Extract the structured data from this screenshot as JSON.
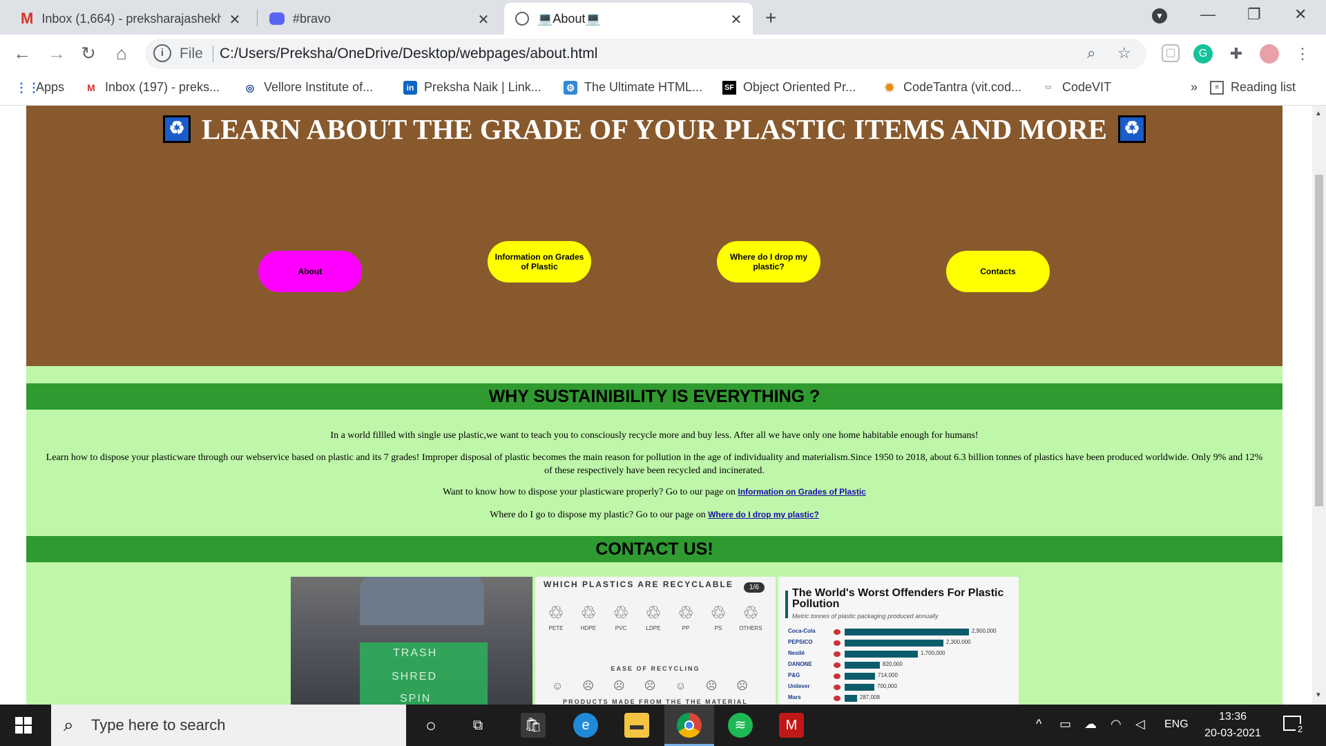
{
  "tabs": [
    {
      "title": "Inbox (1,664) - preksharajashekh",
      "icon": "gmail-icon"
    },
    {
      "title": "#bravo",
      "icon": "discord-icon"
    },
    {
      "title": "💻About💻",
      "icon": "globe-icon"
    }
  ],
  "toolbar": {
    "scheme": "File",
    "url": "C:/Users/Preksha/OneDrive/Desktop/webpages/about.html"
  },
  "bookmarks": {
    "items": [
      {
        "label": "Apps"
      },
      {
        "label": "Inbox (197) - preks..."
      },
      {
        "label": "Vellore Institute of..."
      },
      {
        "label": "Preksha Naik | Link..."
      },
      {
        "label": "The Ultimate HTML..."
      },
      {
        "label": "Object Oriented Pr..."
      },
      {
        "label": "CodeTantra (vit.cod..."
      },
      {
        "label": "CodeVIT"
      }
    ],
    "overflow": "»",
    "reading_list": "Reading list"
  },
  "header": {
    "title": "LEARN ABOUT THE GRADE OF YOUR PLASTIC ITEMS AND MORE"
  },
  "nav": {
    "about": "About",
    "grades": "Information on Grades of Plastic",
    "drop": "Where do I drop my plastic?",
    "contacts": "Contacts"
  },
  "colors": {
    "header_bg": "#88592c",
    "about_pill": "#ff00ff",
    "pill": "#ffff00",
    "page_green": "#bef7a9",
    "section_bar": "#2f9a2f"
  },
  "why": {
    "heading": "WHY SUSTAINIBILITY IS EVERYTHING ?",
    "p1": "In a world fillled with single use plastic,we want to teach you to consciously recycle more and buy less. After all we have only one home habitable enough for humans!",
    "p2": "Learn how to dispose your plasticware through our webservice based on plastic and its 7 grades! Improper disposal of plastic becomes the main reason for pollution in the age of individuality and materialism.Since 1950 to 2018, about 6.3 billion tonnes of plastics have been produced worldwide. Only 9% and 12% of these respectively have been recycled and incinerated.",
    "p3_text": "Want to know how to dispose your plasticware properly? Go to our page on ",
    "p3_link": "Information on Grades of Plastic",
    "p4_text": "Where do I go to dispose my plastic? Go to our page on ",
    "p4_link": "Where do I drop my plastic?"
  },
  "contact": {
    "heading": "CONTACT US!"
  },
  "gallery": {
    "img1": {
      "lines": [
        "TRASH",
        "SHRED",
        "SPIN"
      ]
    },
    "img2": {
      "title": "WHICH PLASTICS ARE RECYCLABLE",
      "badge": "1/6",
      "codes": [
        "PETE",
        "HDPE",
        "PVC",
        "LDPE",
        "PP",
        "PS",
        "OTHERS"
      ],
      "ease": "EASE OF RECYCLING",
      "footer": "PRODUCTS MADE FROM THE THE MATERIAL"
    },
    "img3": {
      "title": "The World's Worst Offenders For Plastic Pollution",
      "subtitle": "Metric tonnes of plastic packaging produced annually",
      "rows": [
        {
          "brand": "Coca-Cola",
          "value": 2900000,
          "label": "2,900,000"
        },
        {
          "brand": "PEPSICO",
          "value": 2300000,
          "label": "2,300,000"
        },
        {
          "brand": "Nestlé",
          "value": 1700000,
          "label": "1,700,000"
        },
        {
          "brand": "DANONE",
          "value": 820000,
          "label": "820,000"
        },
        {
          "brand": "P&G",
          "value": 714000,
          "label": "714,000"
        },
        {
          "brand": "Unilever",
          "value": 700000,
          "label": "700,000"
        },
        {
          "brand": "Mars",
          "value": 287008,
          "label": "287,008"
        }
      ]
    }
  },
  "taskbar": {
    "search_placeholder": "Type here to search",
    "lang": "ENG",
    "time": "13:36",
    "date": "20-03-2021",
    "notifications": "2"
  }
}
